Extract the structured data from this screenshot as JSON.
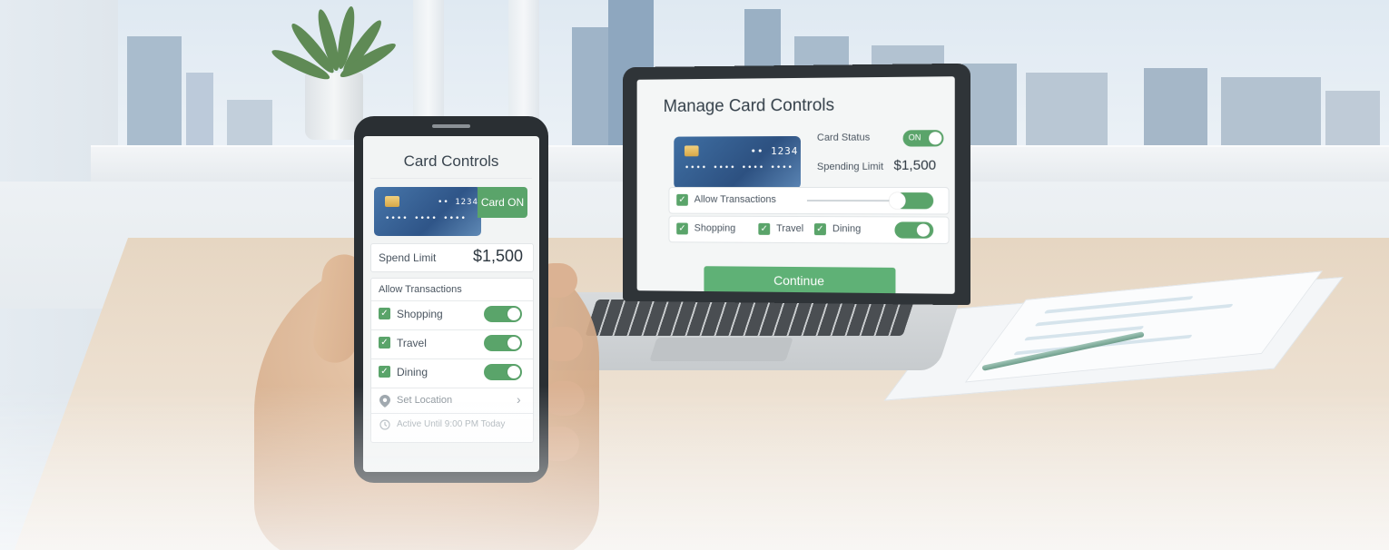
{
  "laptop": {
    "title": "Manage Card Controls",
    "card": {
      "number_prefix": "•• 1234",
      "number_masked": "•••• •••• •••• ••••"
    },
    "card_status": {
      "label": "Card Status",
      "state": "ON"
    },
    "spending_limit": {
      "label": "Spending Limit",
      "value": "$1,500"
    },
    "allow_transactions": {
      "label": "Allow Transactions",
      "checked": true,
      "enabled": true
    },
    "categories": [
      {
        "label": "Shopping",
        "checked": true
      },
      {
        "label": "Travel",
        "checked": true
      },
      {
        "label": "Dining",
        "checked": true
      }
    ],
    "categories_enabled": true,
    "continue_label": "Continue"
  },
  "phone": {
    "title": "Card Controls",
    "card": {
      "number_prefix": "•• 1234",
      "number_masked": "•••• •••• ••••"
    },
    "card_status_label": "Card ON",
    "spend_limit": {
      "label": "Spend Limit",
      "value": "$1,500"
    },
    "allow_transactions_label": "Allow Transactions",
    "toggles": [
      {
        "label": "Shopping",
        "checked": true,
        "enabled": true
      },
      {
        "label": "Travel",
        "checked": true,
        "enabled": true
      },
      {
        "label": "Dining",
        "checked": true,
        "enabled": true
      }
    ],
    "set_location_label": "Set Location",
    "chevron": "›",
    "active_until_label": "Active Until 9:00 PM Today"
  },
  "icons": {
    "location": "location-pin-icon",
    "clock": "clock-icon",
    "check": "checkmark-icon",
    "chevron": "chevron-right-icon",
    "chip": "card-chip-icon"
  },
  "colors": {
    "accent_green": "#5aa46a",
    "card_blue": "#2d5181",
    "text_dark": "#34404a"
  }
}
